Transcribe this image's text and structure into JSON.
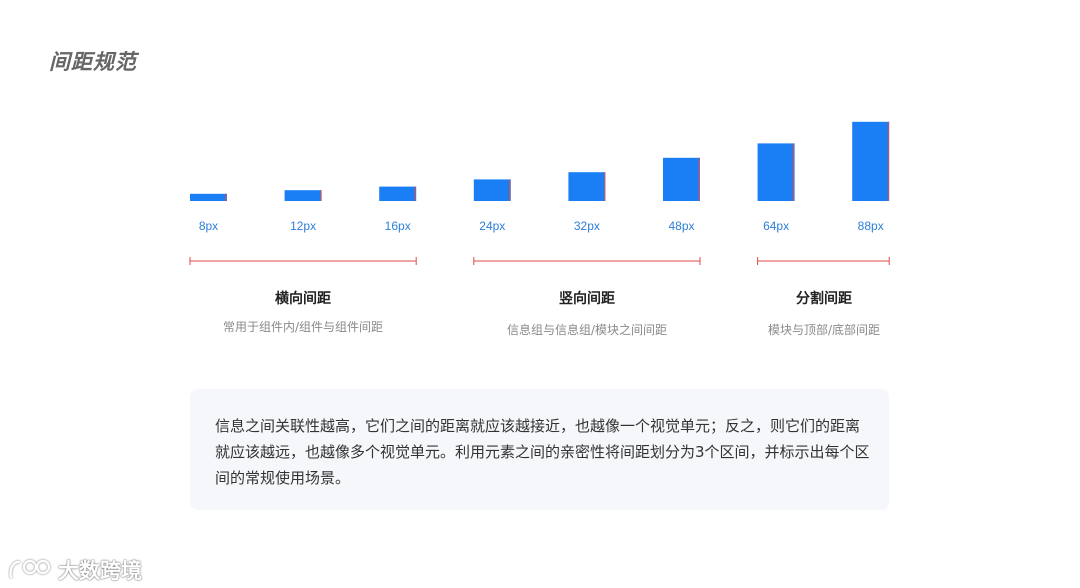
{
  "page": {
    "title": "间距规范"
  },
  "chart_data": {
    "type": "bar",
    "categories": [
      "8px",
      "12px",
      "16px",
      "24px",
      "32px",
      "48px",
      "64px",
      "88px"
    ],
    "values": [
      8,
      12,
      16,
      24,
      32,
      48,
      64,
      88
    ],
    "units": "px",
    "bar_color": "#1a7ef5",
    "marker_color": "#e34a4a",
    "label_color": "#2d7fd9"
  },
  "groups": [
    {
      "title": "横向间距",
      "description": "常用于组件内/组件与组件间距",
      "range": [
        "8px",
        "16px"
      ]
    },
    {
      "title": "竖向间距",
      "description": "信息组与信息组/模块之间间距",
      "range": [
        "24px",
        "48px"
      ]
    },
    {
      "title": "分割间距",
      "description": "模块与顶部/底部间距",
      "range": [
        "64px",
        "88px"
      ]
    }
  ],
  "note": {
    "text": "信息之间关联性越高，它们之间的距离就应该越接近，也越像一个视觉单元；反之，则它们的距离就应该越远，也越像多个视觉单元。利用元素之间的亲密性将间距划分为3个区间，并标示出每个区间的常规使用场景。"
  },
  "watermark": {
    "logo_icon": "panda-logo-icon",
    "text": "大数跨境"
  }
}
